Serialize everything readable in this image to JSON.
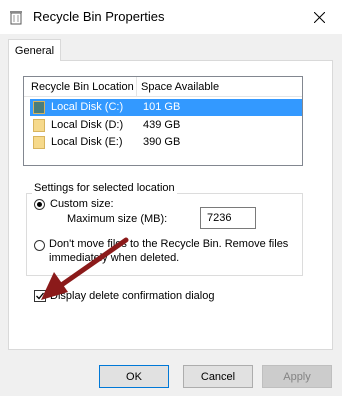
{
  "window": {
    "title": "Recycle Bin Properties"
  },
  "tabs": [
    "General"
  ],
  "list": {
    "headers": [
      "Recycle Bin Location",
      "Space Available"
    ],
    "rows": [
      {
        "name": "Local Disk (C:)",
        "space": "101 GB",
        "selected": true
      },
      {
        "name": "Local Disk (D:)",
        "space": "439 GB",
        "selected": false
      },
      {
        "name": "Local Disk (E:)",
        "space": "390 GB",
        "selected": false
      }
    ]
  },
  "settings": {
    "group_label": "Settings for selected location",
    "custom_size_label": "Custom size:",
    "max_size_label": "Maximum size (MB):",
    "max_size_value": "7236",
    "dont_move_label_line1": "Don't move files to the Recycle Bin. Remove files",
    "dont_move_label_line2": "immediately when deleted."
  },
  "confirm": {
    "label": "Display delete confirmation dialog",
    "checked": true
  },
  "buttons": {
    "ok": "OK",
    "cancel": "Cancel",
    "apply": "Apply"
  },
  "colors": {
    "selection": "#3399ff",
    "arrow": "#8b1a1a",
    "accent": "#0078d7"
  }
}
